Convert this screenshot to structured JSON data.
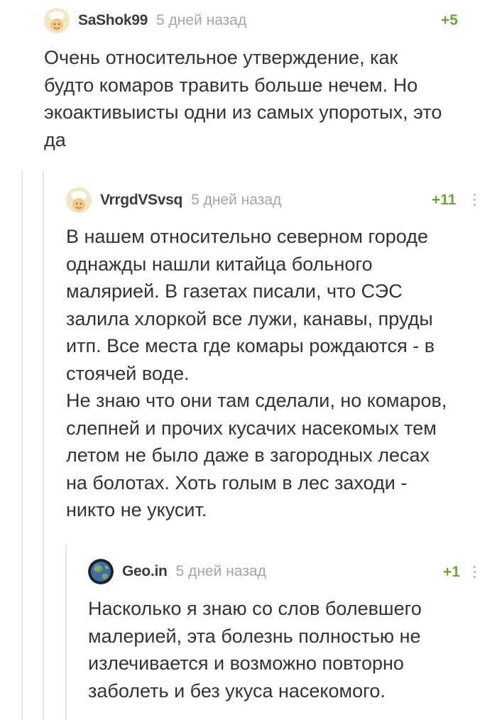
{
  "comments": [
    {
      "username": "SaShok99",
      "time": "5 дней назад",
      "rating": "+5",
      "avatar_icon": "default-chef-avatar-icon",
      "text": "Очень относительное утверждение, как\nбудто комаров травить больше нечем. Но\nэкоактивыисты одни из самых упоротых, это\nда"
    },
    {
      "username": "VrrgdVSvsq",
      "time": "5 дней назад",
      "rating": "+11",
      "avatar_icon": "default-chef-avatar-icon",
      "text": "В нашем относительно северном городе\nоднажды нашли китайца больного\nмалярией. В газетах писали, что СЭС\nзалила хлоркой все лужи, канавы, пруды\nитп. Все места где комары рождаются - в\nстоячей воде.\nНе знаю что они там сделали, но комаров,\nслепней и прочих кусачих насекомых тем\nлетом не было даже в загородных лесах\nна болотах. Хоть голым в лес заходи -\nникто не укусит."
    },
    {
      "username": "Geo.in",
      "time": "5 дней назад",
      "rating": "+1",
      "avatar_icon": "globe-avatar-icon",
      "text": "Насколько я знаю со слов болевшего\nмалерией, эта болезнь полностью не\nизлечивается и возможно повторно\nзаболеть и без укуса насекомого."
    }
  ],
  "colors": {
    "rating": "#6fa23a",
    "time": "#a5a5a5",
    "username": "#3b3b3b",
    "text": "#333333",
    "thread_line": "#e6e6e6"
  }
}
